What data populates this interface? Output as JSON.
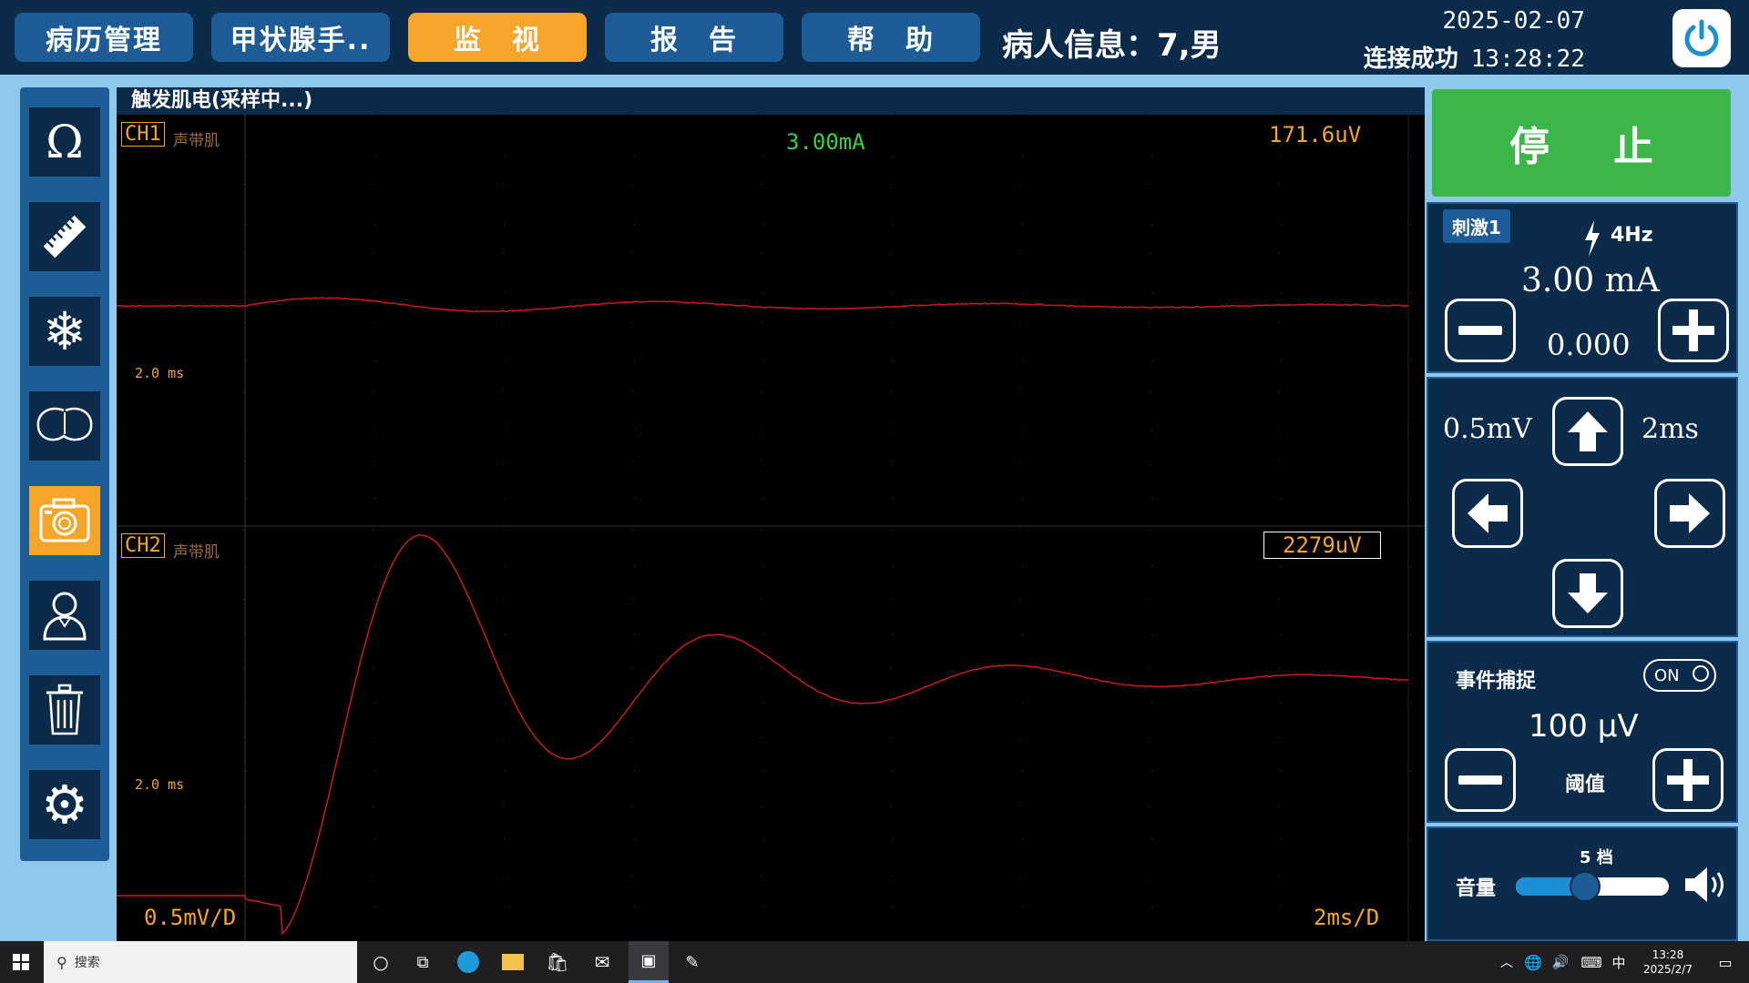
{
  "nav": {
    "items": [
      "病历管理",
      "甲状腺手..",
      "监　视",
      "报　告",
      "帮　助"
    ],
    "patient_info": "病人信息：7,男",
    "date": "2025-02-07",
    "status": "连接成功",
    "time": "13:28:22"
  },
  "graph": {
    "title": "触发肌电(采样中...)",
    "ch1": {
      "label": "CH1",
      "muscle": "声带肌",
      "amplitude": "171.6uV",
      "current": "3.00mA",
      "time_scale": "2.0 ms"
    },
    "ch2": {
      "label": "CH2",
      "muscle": "声带肌",
      "amplitude": "2279uV",
      "time_scale": "2.0 ms"
    },
    "vertical_scale": "0.5mV/D",
    "horizontal_scale": "2ms/D"
  },
  "control": {
    "stop_label": "停止",
    "stim_badge": "刺激1",
    "frequency": "4Hz",
    "current": "3.00 mA",
    "measured": "0.000",
    "sensitivity": "0.5mV",
    "sweep": "2ms",
    "event_capture_label": "事件捕捉",
    "event_toggle": "ON",
    "threshold_value": "100 μV",
    "threshold_label": "阈值",
    "volume_label": "音量",
    "volume_level": "5 档",
    "volume_fraction": 0.45
  },
  "taskbar": {
    "search_placeholder": "搜索",
    "ime": "中",
    "time": "13:28",
    "date": "2025/2/7"
  },
  "colors": {
    "trace": "#cc1a1a",
    "accent": "#f5a52a",
    "stop": "#3cb64a",
    "panel": "#0c2a4a"
  }
}
